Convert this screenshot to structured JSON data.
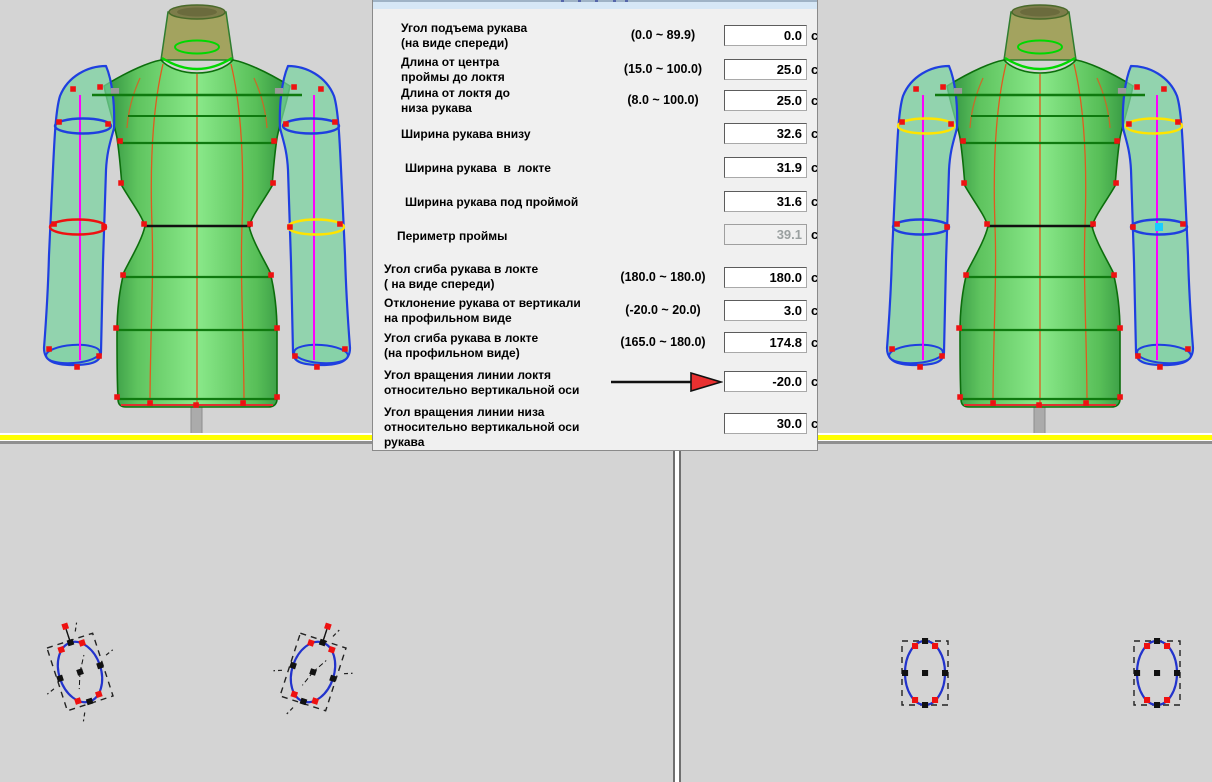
{
  "dialog": {
    "unit": "с",
    "rows": [
      {
        "label": "Угол подъема рукава\n(на виде спереди)",
        "range": "(0.0 ~ 89.9)",
        "value": "0.0",
        "readonly": false,
        "arrow": false
      },
      {
        "label": "Длина от центра\nпроймы до локтя",
        "range": "(15.0 ~ 100.0)",
        "value": "25.0",
        "readonly": false,
        "arrow": false
      },
      {
        "label": "Длина от локтя до\nниза рукава",
        "range": "(8.0 ~ 100.0)",
        "value": "25.0",
        "readonly": false,
        "arrow": false
      },
      {
        "label": "Ширина рукава внизу",
        "range": "",
        "value": "32.6",
        "readonly": false,
        "arrow": false
      },
      {
        "label": "Ширина рукава  в  локте",
        "range": "",
        "value": "31.9",
        "readonly": false,
        "arrow": false
      },
      {
        "label": "Ширина рукава под проймой",
        "range": "",
        "value": "31.6",
        "readonly": false,
        "arrow": false
      },
      {
        "label": "Периметр проймы",
        "range": "",
        "value": "39.1",
        "readonly": true,
        "arrow": false
      },
      {
        "label": "Угол сгиба рукава в локте\n( на виде спереди)",
        "range": "(180.0 ~ 180.0)",
        "value": "180.0",
        "readonly": false,
        "arrow": false
      },
      {
        "label": "Отклонение рукава от вертикали\nна профильном виде",
        "range": "(-20.0 ~ 20.0)",
        "value": "3.0",
        "readonly": false,
        "arrow": false
      },
      {
        "label": "Угол сгиба рукава в локте\n(на профильном виде)",
        "range": "(165.0 ~ 180.0)",
        "value": "174.8",
        "readonly": false,
        "arrow": false
      },
      {
        "label": "Угол вращения линии локтя\nотносительно вертикальной оси",
        "range": "",
        "value": "-20.0",
        "readonly": false,
        "arrow": true
      },
      {
        "label": "Угол вращения линии низа\nотносительно вертикальной оси\nрукава",
        "range": "",
        "value": "30.0",
        "readonly": false,
        "arrow": false
      }
    ]
  },
  "colors": {
    "palette": {
      "pane_bg": "#d4d4d4",
      "dialog_bg": "#f0f0f0",
      "floor_yellow": "#ffff00",
      "curve_blue": "#1f3fe0",
      "point_red": "#ee1111",
      "point_black": "#111111",
      "magenta": "#ff00ff",
      "body_green_mid": "#8ae98a",
      "body_green_edge": "#2e8f3e",
      "line_green": "#0f7a0f",
      "neck_green": "#00d800",
      "seam_orange": "#e05a1e",
      "arrow_red": "#e83030",
      "cyan_dot": "#19ccff",
      "ring_yellow": "#ffe400"
    },
    "left_mannequin": {
      "ring-upper-l": "#1f3fe0",
      "ring-upper-r": "#1f3fe0",
      "ring-elbow-l": "#ee1111",
      "ring-elbow-r": "#ffe400",
      "dot-l": "transparent",
      "dot-r": "transparent"
    },
    "right_mannequin": {
      "ring-upper-l": "#ffe400",
      "ring-upper-r": "#ffe400",
      "ring-elbow-l": "#1f3fe0",
      "ring-elbow-r": "#1f3fe0",
      "dot-l": "transparent",
      "dot-r": "#19ccff"
    }
  }
}
